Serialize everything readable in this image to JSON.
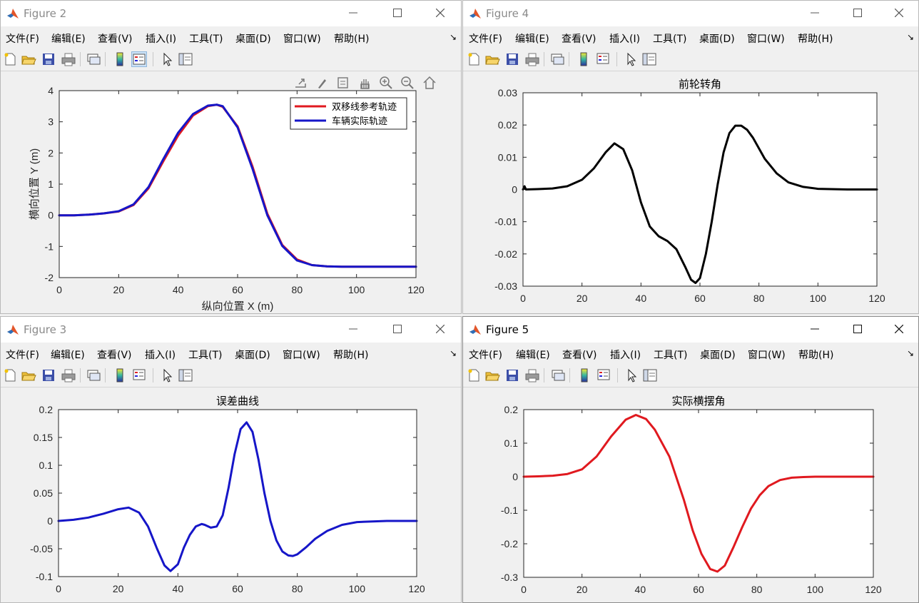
{
  "windows": [
    {
      "id": "fig2",
      "title": "Figure 2",
      "active": false,
      "menu": [
        "文件(F)",
        "编辑(E)",
        "查看(V)",
        "插入(I)",
        "工具(T)",
        "桌面(D)",
        "窗口(W)",
        "帮助(H)"
      ],
      "axes_toolbar": [
        "export-icon",
        "brush-icon",
        "datatip-icon",
        "pan-icon",
        "zoom-in-icon",
        "zoom-out-icon",
        "home-icon"
      ],
      "chart_data": {
        "type": "line",
        "title": "",
        "xlabel": "纵向位置 X (m)",
        "ylabel": "横向位置 Y (m)",
        "xlim": [
          0,
          120
        ],
        "ylim": [
          -2,
          4
        ],
        "xticks": [
          0,
          20,
          40,
          60,
          80,
          100,
          120
        ],
        "yticks": [
          -2,
          -1,
          0,
          1,
          2,
          3,
          4
        ],
        "tick_labels_x": [
          "0",
          "20",
          "40",
          "60",
          "80",
          "100",
          "120"
        ],
        "tick_labels_y": [
          "-2",
          "-1",
          "0",
          "1",
          "2",
          "3",
          "4"
        ],
        "grid": false,
        "legend": "top-right",
        "series": [
          {
            "name": "双移线参考轨迹",
            "color": "#e0191f",
            "x": [
              0,
              5,
              10,
              15,
              20,
              25,
              30,
              35,
              40,
              45,
              50,
              53,
              55,
              60,
              65,
              70,
              75,
              80,
              85,
              90,
              95,
              100,
              110,
              120
            ],
            "y": [
              0,
              0,
              0.02,
              0.06,
              0.12,
              0.33,
              0.86,
              1.73,
              2.56,
              3.2,
              3.5,
              3.55,
              3.48,
              2.85,
              1.57,
              0.05,
              -0.95,
              -1.42,
              -1.6,
              -1.64,
              -1.65,
              -1.65,
              -1.65,
              -1.65
            ]
          },
          {
            "name": "车辆实际轨迹",
            "color": "#1616c8",
            "x": [
              0,
              5,
              10,
              15,
              20,
              25,
              30,
              35,
              40,
              45,
              50,
              53,
              55,
              60,
              65,
              70,
              75,
              80,
              85,
              90,
              95,
              100,
              110,
              120
            ],
            "y": [
              0,
              0,
              0.02,
              0.06,
              0.13,
              0.35,
              0.9,
              1.8,
              2.65,
              3.25,
              3.52,
              3.55,
              3.5,
              2.82,
              1.5,
              0.0,
              -0.98,
              -1.45,
              -1.6,
              -1.64,
              -1.65,
              -1.65,
              -1.65,
              -1.65
            ]
          }
        ]
      }
    },
    {
      "id": "fig4",
      "title": "Figure 4",
      "active": false,
      "menu": [
        "文件(F)",
        "编辑(E)",
        "查看(V)",
        "插入(I)",
        "工具(T)",
        "桌面(D)",
        "窗口(W)",
        "帮助(H)"
      ],
      "chart_data": {
        "type": "line",
        "title": "前轮转角",
        "xlabel": "",
        "ylabel": "",
        "xlim": [
          0,
          120
        ],
        "ylim": [
          -0.03,
          0.03
        ],
        "xticks": [
          0,
          20,
          40,
          60,
          80,
          100,
          120
        ],
        "yticks": [
          -0.03,
          -0.02,
          -0.01,
          0,
          0.01,
          0.02,
          0.03
        ],
        "tick_labels_x": [
          "0",
          "20",
          "40",
          "60",
          "80",
          "100",
          "120"
        ],
        "tick_labels_y": [
          "-0.03",
          "-0.02",
          "-0.01",
          "0",
          "0.01",
          "0.02",
          "0.03"
        ],
        "grid": false,
        "series": [
          {
            "color": "#000000",
            "x": [
              0,
              0.5,
              1,
              5,
              10,
              15,
              20,
              24,
              28,
              31,
              34,
              37,
              40,
              43,
              46,
              49,
              52,
              55,
              57,
              58.5,
              60,
              62,
              64,
              66,
              68,
              70,
              72,
              74,
              76,
              78,
              82,
              86,
              90,
              95,
              100,
              110,
              120
            ],
            "y": [
              0,
              0.001,
              0,
              0.0001,
              0.0003,
              0.001,
              0.003,
              0.0065,
              0.0115,
              0.0143,
              0.0125,
              0.006,
              -0.004,
              -0.0115,
              -0.0145,
              -0.016,
              -0.0185,
              -0.024,
              -0.028,
              -0.029,
              -0.0275,
              -0.02,
              -0.01,
              0.0015,
              0.0115,
              0.0175,
              0.0198,
              0.0198,
              0.0185,
              0.016,
              0.0095,
              0.005,
              0.0022,
              0.0008,
              0.0002,
              0,
              0
            ]
          }
        ]
      }
    },
    {
      "id": "fig3",
      "title": "Figure 3",
      "active": false,
      "menu": [
        "文件(F)",
        "编辑(E)",
        "查看(V)",
        "插入(I)",
        "工具(T)",
        "桌面(D)",
        "窗口(W)",
        "帮助(H)"
      ],
      "chart_data": {
        "type": "line",
        "title": "误差曲线",
        "xlabel": "",
        "ylabel": "",
        "xlim": [
          0,
          120
        ],
        "ylim": [
          -0.1,
          0.2
        ],
        "xticks": [
          0,
          20,
          40,
          60,
          80,
          100,
          120
        ],
        "yticks": [
          -0.1,
          -0.05,
          0,
          0.05,
          0.1,
          0.15,
          0.2
        ],
        "tick_labels_x": [
          "0",
          "20",
          "40",
          "60",
          "80",
          "100",
          "120"
        ],
        "tick_labels_y": [
          "-0.1",
          "-0.05",
          "0",
          "0.05",
          "0.1",
          "0.15",
          "0.2"
        ],
        "grid": false,
        "series": [
          {
            "color": "#1616c8",
            "x": [
              0,
              5,
              10,
              15,
              20,
              23.5,
              27,
              30,
              33,
              35.5,
              37.5,
              40,
              42,
              44,
              46,
              48,
              49,
              51,
              53,
              55,
              57,
              59,
              61,
              63,
              65,
              67,
              69,
              71,
              73,
              75,
              77,
              78.5,
              80,
              83,
              86,
              90,
              95,
              100,
              110,
              120
            ],
            "y": [
              0,
              0.002,
              0.006,
              0.013,
              0.021,
              0.024,
              0.015,
              -0.01,
              -0.05,
              -0.08,
              -0.09,
              -0.078,
              -0.048,
              -0.025,
              -0.01,
              -0.0055,
              -0.007,
              -0.012,
              -0.01,
              0.01,
              0.06,
              0.12,
              0.165,
              0.177,
              0.16,
              0.11,
              0.05,
              0.0,
              -0.035,
              -0.055,
              -0.062,
              -0.063,
              -0.06,
              -0.047,
              -0.032,
              -0.018,
              -0.007,
              -0.002,
              0,
              0
            ]
          }
        ]
      }
    },
    {
      "id": "fig5",
      "title": "Figure 5",
      "active": true,
      "menu": [
        "文件(F)",
        "编辑(E)",
        "查看(V)",
        "插入(I)",
        "工具(T)",
        "桌面(D)",
        "窗口(W)",
        "帮助(H)"
      ],
      "chart_data": {
        "type": "line",
        "title": "实际横摆角",
        "xlabel": "",
        "ylabel": "",
        "xlim": [
          0,
          120
        ],
        "ylim": [
          -0.3,
          0.2
        ],
        "xticks": [
          0,
          20,
          40,
          60,
          80,
          100,
          120
        ],
        "yticks": [
          -0.3,
          -0.2,
          -0.1,
          0,
          0.1,
          0.2
        ],
        "tick_labels_x": [
          "0",
          "20",
          "40",
          "60",
          "80",
          "100",
          "120"
        ],
        "tick_labels_y": [
          "-0.3",
          "-0.2",
          "-0.1",
          "0",
          "0.1",
          "0.2"
        ],
        "grid": false,
        "series": [
          {
            "color": "#e0191f",
            "x": [
              0,
              5,
              10,
              15,
              20,
              25,
              30,
              35,
              38.5,
              42,
              45,
              50,
              55,
              58,
              61,
              64,
              66.5,
              69,
              72,
              75,
              78,
              81,
              84,
              88,
              92,
              96,
              100,
              110,
              120
            ],
            "y": [
              0,
              0.001,
              0.003,
              0.008,
              0.022,
              0.06,
              0.12,
              0.17,
              0.184,
              0.172,
              0.14,
              0.06,
              -0.07,
              -0.16,
              -0.23,
              -0.275,
              -0.283,
              -0.265,
              -0.21,
              -0.15,
              -0.095,
              -0.055,
              -0.028,
              -0.01,
              -0.003,
              -0.001,
              0,
              0,
              0
            ]
          }
        ]
      }
    }
  ]
}
